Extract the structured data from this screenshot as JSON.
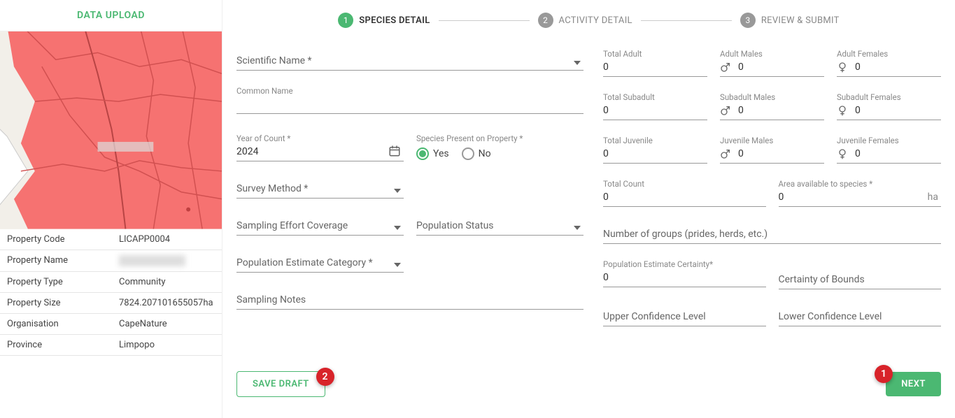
{
  "sidebar": {
    "title": "DATA UPLOAD",
    "properties": [
      {
        "label": "Property Code",
        "value": "LICAPP0004"
      },
      {
        "label": "Property Name",
        "value": "██████"
      },
      {
        "label": "Property Type",
        "value": "Community"
      },
      {
        "label": "Property Size",
        "value": "7824.207101655057ha"
      },
      {
        "label": "Organisation",
        "value": "CapeNature"
      },
      {
        "label": "Province",
        "value": "Limpopo"
      }
    ]
  },
  "stepper": {
    "steps": [
      {
        "num": "1",
        "label": "SPECIES DETAIL",
        "active": true
      },
      {
        "num": "2",
        "label": "ACTIVITY DETAIL",
        "active": false
      },
      {
        "num": "3",
        "label": "REVIEW & SUBMIT",
        "active": false
      }
    ]
  },
  "form": {
    "scientific_name_label": "Scientific Name *",
    "common_name_label": "Common Name",
    "year_of_count_label": "Year of Count *",
    "year_of_count_value": "2024",
    "species_present_label": "Species Present on Property *",
    "species_yes": "Yes",
    "species_no": "No",
    "survey_method_label": "Survey Method *",
    "sampling_effort_label": "Sampling Effort Coverage",
    "population_status_label": "Population Status",
    "population_estimate_category_label": "Population Estimate Category *",
    "sampling_notes_label": "Sampling Notes",
    "total_adult_label": "Total Adult",
    "total_adult_value": "0",
    "adult_males_label": "Adult Males",
    "adult_males_value": "0",
    "adult_females_label": "Adult Females",
    "adult_females_value": "0",
    "total_subadult_label": "Total Subadult",
    "total_subadult_value": "0",
    "subadult_males_label": "Subadult Males",
    "subadult_males_value": "0",
    "subadult_females_label": "Subadult Females",
    "subadult_females_value": "0",
    "total_juvenile_label": "Total Juvenile",
    "total_juvenile_value": "0",
    "juvenile_males_label": "Juvenile Males",
    "juvenile_males_value": "0",
    "juvenile_females_label": "Juvenile Females",
    "juvenile_females_value": "0",
    "total_count_label": "Total Count",
    "total_count_value": "0",
    "area_available_label": "Area available to species *",
    "area_available_value": "0",
    "area_unit": "ha",
    "number_groups_label": "Number of groups (prides, herds, etc.)",
    "population_estimate_certainty_label": "Population Estimate Certainty*",
    "population_estimate_certainty_value": "0",
    "certainty_bounds_label": "Certainty of Bounds",
    "upper_confidence_label": "Upper Confidence Level",
    "lower_confidence_label": "Lower Confidence Level"
  },
  "buttons": {
    "save_draft": "SAVE DRAFT",
    "next": "NEXT",
    "badge_save": "2",
    "badge_next": "1"
  }
}
